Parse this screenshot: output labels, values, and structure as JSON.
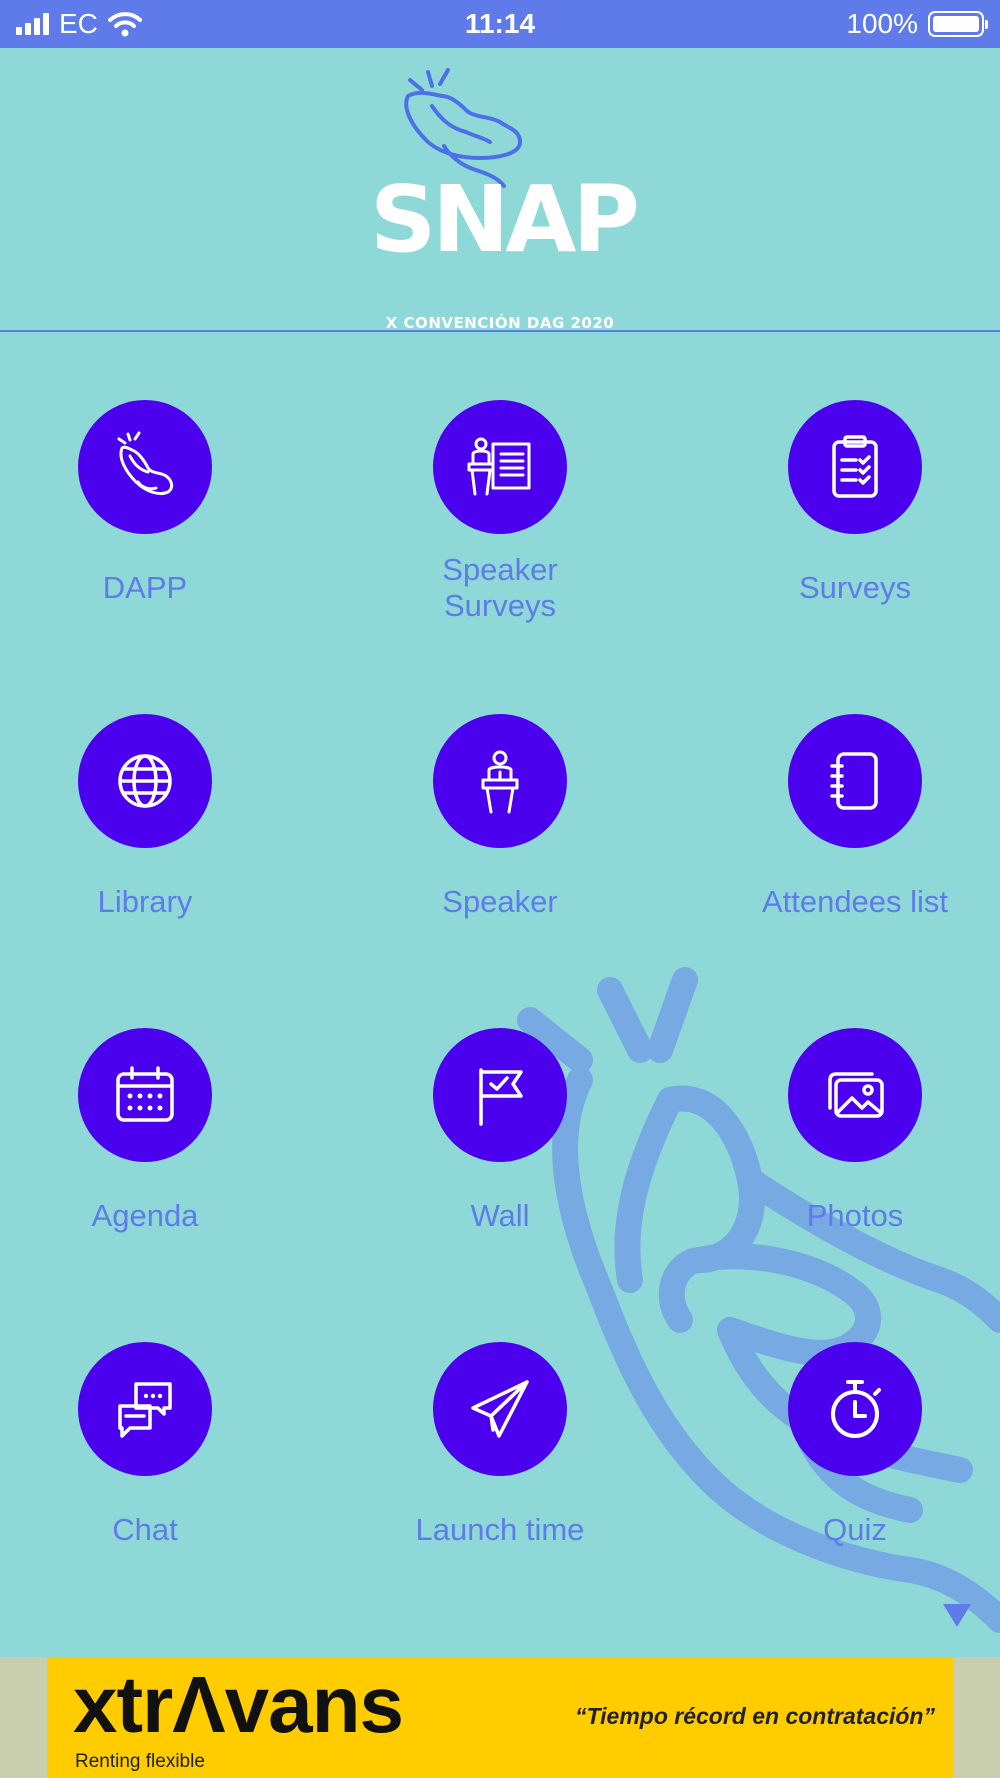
{
  "status_bar": {
    "carrier": "EC",
    "time": "11:14",
    "battery": "100%",
    "icons": [
      "signal-icon",
      "wifi-icon",
      "battery-icon"
    ]
  },
  "header": {
    "logo_title": "SNAP",
    "logo_subtitle": "X CONVENCIÓN DAG 2020"
  },
  "menu": {
    "items": [
      {
        "label": "DAPP",
        "icon": "snap-hand-icon"
      },
      {
        "label": "Speaker Surveys",
        "label_line1": "Speaker",
        "label_line2": "Surveys",
        "icon": "presentation-icon"
      },
      {
        "label": "Surveys",
        "icon": "clipboard-checklist-icon"
      },
      {
        "label": "Library",
        "icon": "globe-icon"
      },
      {
        "label": "Speaker",
        "icon": "podium-speaker-icon"
      },
      {
        "label": "Attendees list",
        "icon": "notebook-icon"
      },
      {
        "label": "Agenda",
        "icon": "calendar-icon"
      },
      {
        "label": "Wall",
        "icon": "flag-check-icon"
      },
      {
        "label": "Photos",
        "icon": "photos-icon"
      },
      {
        "label": "Chat",
        "icon": "chat-bubbles-icon"
      },
      {
        "label": "Launch time",
        "icon": "paper-plane-icon"
      },
      {
        "label": "Quiz",
        "icon": "stopwatch-icon"
      }
    ]
  },
  "ad": {
    "brand": "xtrΛvans",
    "tagline": "Renting flexible",
    "slogan": "“Tiempo récord en contratación”"
  },
  "colors": {
    "background": "#8fd8d8",
    "status_bar": "#5f7bea",
    "icon_circle": "#4b00ee",
    "label": "#5f7bea",
    "ad_yellow": "#ffcc00"
  }
}
